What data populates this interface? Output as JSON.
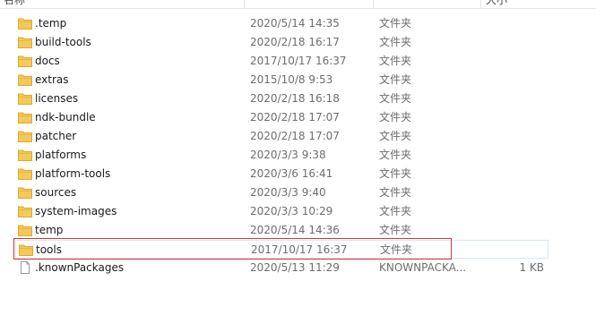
{
  "header": {
    "name_label": "名称",
    "date_label": "",
    "type_label": "",
    "size_label": "大小"
  },
  "rows": [
    {
      "name": ".temp",
      "date": "2020/5/14 14:35",
      "type": "文件夹",
      "size": "",
      "icon": "folder-icon"
    },
    {
      "name": "build-tools",
      "date": "2020/2/18 16:17",
      "type": "文件夹",
      "size": "",
      "icon": "folder-icon"
    },
    {
      "name": "docs",
      "date": "2017/10/17 16:37",
      "type": "文件夹",
      "size": "",
      "icon": "folder-icon"
    },
    {
      "name": "extras",
      "date": "2015/10/8 9:53",
      "type": "文件夹",
      "size": "",
      "icon": "folder-icon"
    },
    {
      "name": "licenses",
      "date": "2020/2/18 16:18",
      "type": "文件夹",
      "size": "",
      "icon": "folder-icon"
    },
    {
      "name": "ndk-bundle",
      "date": "2020/2/18 17:07",
      "type": "文件夹",
      "size": "",
      "icon": "folder-icon"
    },
    {
      "name": "patcher",
      "date": "2020/2/18 17:07",
      "type": "文件夹",
      "size": "",
      "icon": "folder-icon"
    },
    {
      "name": "platforms",
      "date": "2020/3/3 9:38",
      "type": "文件夹",
      "size": "",
      "icon": "folder-icon"
    },
    {
      "name": "platform-tools",
      "date": "2020/3/6 16:41",
      "type": "文件夹",
      "size": "",
      "icon": "folder-icon"
    },
    {
      "name": "sources",
      "date": "2020/3/3 9:40",
      "type": "文件夹",
      "size": "",
      "icon": "folder-icon"
    },
    {
      "name": "system-images",
      "date": "2020/3/3 10:29",
      "type": "文件夹",
      "size": "",
      "icon": "folder-icon"
    },
    {
      "name": "temp",
      "date": "2020/5/14 14:36",
      "type": "文件夹",
      "size": "",
      "icon": "folder-icon"
    },
    {
      "name": "tools",
      "date": "2017/10/17 16:37",
      "type": "文件夹",
      "size": "",
      "icon": "folder-icon"
    },
    {
      "name": ".knownPackages",
      "date": "2020/5/13 11:29",
      "type": "KNOWNPACKA...",
      "size": "1 KB",
      "icon": "file-icon"
    }
  ],
  "colors": {
    "folder": "#f5c85a",
    "folder_dark": "#e0a82e",
    "highlight_border": "#cf3a3a",
    "hover_border": "#d6e8f6"
  }
}
